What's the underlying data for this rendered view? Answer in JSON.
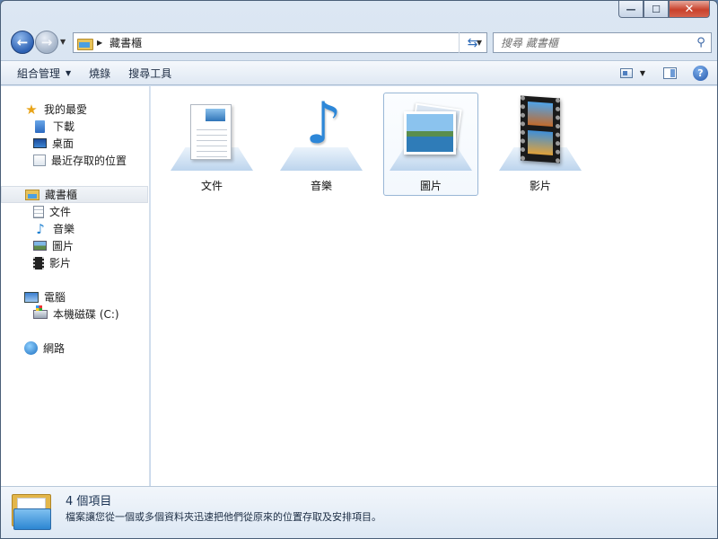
{
  "window": {
    "caption_min": "—",
    "caption_max": "☐",
    "caption_close": "✕"
  },
  "nav": {
    "back_glyph": "←",
    "forward_glyph": "→",
    "refresh_glyph": "⇆",
    "address_path": "藏書櫃",
    "search_placeholder": "搜尋 藏書櫃"
  },
  "toolbar": {
    "organize": "組合管理",
    "burn": "燒錄",
    "search_tools": "搜尋工具"
  },
  "sidebar": {
    "favorites": "我的最愛",
    "downloads": "下載",
    "desktop": "桌面",
    "recent": "最近存取的位置",
    "libraries": "藏書櫃",
    "documents": "文件",
    "music": "音樂",
    "pictures": "圖片",
    "videos": "影片",
    "computer": "電腦",
    "local_disk": "本機磁碟 (C:)",
    "network": "網路"
  },
  "library_items": [
    {
      "label": "文件",
      "icon": "documents-library-icon"
    },
    {
      "label": "音樂",
      "icon": "music-library-icon"
    },
    {
      "label": "圖片",
      "icon": "pictures-library-icon",
      "selected": true
    },
    {
      "label": "影片",
      "icon": "videos-library-icon"
    }
  ],
  "details": {
    "count": "4 個項目",
    "description": "檔案讓您從一個或多個資料夾迅速把他們從原來的位置存取及安排項目。"
  },
  "colors": {
    "accent": "#2e62b4",
    "close_button": "#c9412b",
    "selection_border": "#99b7d6"
  }
}
